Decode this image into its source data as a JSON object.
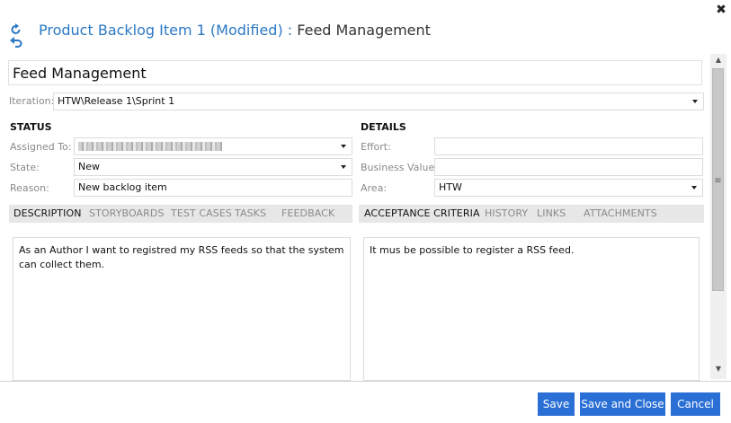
{
  "dialog": {
    "title_type": "Product Backlog Item 1 (Modified)",
    "title_separator": ":",
    "title_name": "Feed Management",
    "close_glyph": "✖"
  },
  "work_item": {
    "title": "Feed Management",
    "iteration_label": "Iteration:",
    "iteration_value": "HTW\\Release 1\\Sprint 1"
  },
  "status": {
    "heading": "STATUS",
    "assigned_to_label": "Assigned To:",
    "state_label": "State:",
    "state_value": "New",
    "reason_label": "Reason:",
    "reason_value": "New backlog item"
  },
  "details": {
    "heading": "DETAILS",
    "effort_label": "Effort:",
    "effort_value": "",
    "business_value_label": "Business Value:",
    "business_value_value": "",
    "area_label": "Area:",
    "area_value": "HTW"
  },
  "left_tabs": [
    {
      "label": "DESCRIPTION",
      "active": true
    },
    {
      "label": "STORYBOARDS",
      "active": false
    },
    {
      "label": "TEST CASES",
      "active": false
    },
    {
      "label": "TASKS",
      "active": false
    },
    {
      "label": "FEEDBACK",
      "active": false
    }
  ],
  "right_tabs": [
    {
      "label": "ACCEPTANCE CRITERIA",
      "active": true
    },
    {
      "label": "HISTORY",
      "active": false
    },
    {
      "label": "LINKS",
      "active": false
    },
    {
      "label": "ATTACHMENTS",
      "active": false
    }
  ],
  "description_text": "As an Author I want to registred my RSS feeds so that the system can collect them.",
  "acceptance_text": "It mus be possible to register a RSS feed.",
  "scrollbar": {
    "up_glyph": "▲",
    "down_glyph": "▼",
    "grip_glyph": "≡"
  },
  "footer": {
    "save_label": "Save",
    "save_close_label": "Save and Close",
    "cancel_label": "Cancel"
  },
  "colors": {
    "accent": "#2a6fd6",
    "title_blue": "#2b78c4",
    "tab_bar": "#e7e7e7"
  },
  "icons": [
    "refresh-icon",
    "undo-icon",
    "dropdown-arrow-icon",
    "close-icon"
  ]
}
